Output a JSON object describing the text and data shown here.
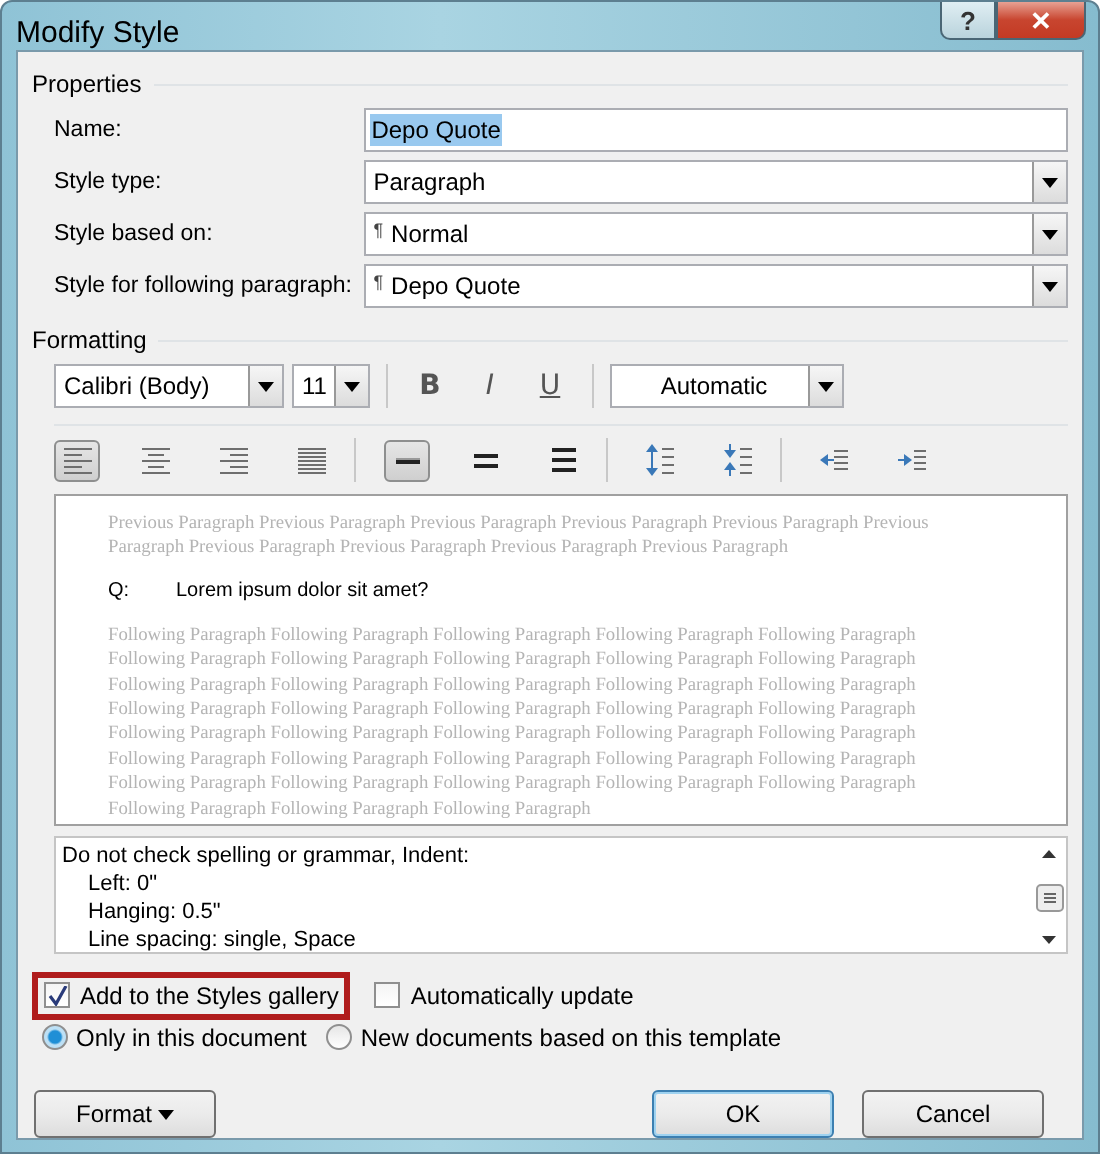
{
  "window": {
    "title": "Modify Style",
    "controls": [
      "?",
      "✕"
    ]
  },
  "properties": {
    "title": "Properties",
    "fields": [
      {
        "label": "Name:",
        "kind": "text",
        "value": "Depo Quote",
        "selected": true
      },
      {
        "label": "Style type:",
        "kind": "dropdown",
        "value": "Paragraph"
      },
      {
        "label": "Style based on:",
        "kind": "dropdown",
        "value": "Normal",
        "prefix": "¶"
      },
      {
        "label": "Style for following paragraph:",
        "kind": "dropdown",
        "value": "Depo Quote",
        "prefix": "¶"
      }
    ]
  },
  "formatting": {
    "title": "Formatting",
    "font": "Calibri (Body)",
    "size": "11",
    "styles": [
      {
        "label": "B",
        "kind": "bold"
      },
      {
        "label": "I",
        "kind": "italic"
      },
      {
        "label": "U",
        "kind": "underline"
      }
    ],
    "font_color_name": "Automatic",
    "tool_groups": [
      [
        {
          "kind": "align-left",
          "selected": true
        },
        {
          "kind": "align-center",
          "selected": false
        },
        {
          "kind": "align-right",
          "selected": false
        },
        {
          "kind": "justify",
          "selected": false
        }
      ],
      [
        {
          "kind": "single",
          "selected": true
        },
        {
          "kind": "one-half",
          "selected": false
        },
        {
          "kind": "double",
          "selected": false
        }
      ],
      [
        {
          "kind": "space-more",
          "selected": false
        },
        {
          "kind": "space-less",
          "selected": false
        }
      ],
      [
        {
          "kind": "outdent",
          "selected": false
        },
        {
          "kind": "indent",
          "selected": false
        }
      ]
    ]
  },
  "preview": {
    "previous_lines": [
      "Previous Paragraph Previous Paragraph Previous Paragraph Previous Paragraph Previous Paragraph Previous",
      "Paragraph Previous Paragraph Previous Paragraph Previous Paragraph Previous Paragraph"
    ],
    "sample_label": "Q:",
    "sample_text": "Lorem ipsum dolor sit amet?",
    "following_lines": [
      "Following Paragraph Following Paragraph Following Paragraph Following Paragraph Following Paragraph",
      "Following Paragraph Following Paragraph Following Paragraph Following Paragraph Following Paragraph",
      "Following Paragraph Following Paragraph Following Paragraph Following Paragraph Following Paragraph",
      "Following Paragraph Following Paragraph Following Paragraph Following Paragraph Following Paragraph",
      "Following Paragraph Following Paragraph Following Paragraph Following Paragraph Following Paragraph",
      "Following Paragraph Following Paragraph Following Paragraph Following Paragraph Following Paragraph",
      "Following Paragraph Following Paragraph Following Paragraph Following Paragraph Following Paragraph",
      "Following Paragraph Following Paragraph Following Paragraph"
    ]
  },
  "description": {
    "text": "Do not check spelling or grammar, Indent:",
    "children": [
      {
        "text": "Left:  0\""
      },
      {
        "text": "Hanging:  0.5\""
      },
      {
        "text": "Line spacing:  single, Space"
      }
    ]
  },
  "checkboxes": [
    {
      "label": "Add to the Styles gallery",
      "checked": true,
      "highlighted": true
    },
    {
      "label": "Automatically update",
      "checked": false,
      "highlighted": false
    }
  ],
  "radios": [
    {
      "label": "Only in this document",
      "selected": true
    },
    {
      "label": "New documents based on this template",
      "selected": false
    }
  ],
  "buttons": [
    {
      "label": "Format",
      "kind": "menu"
    },
    {
      "label": "OK",
      "kind": "default"
    },
    {
      "label": "Cancel",
      "kind": "normal"
    }
  ]
}
